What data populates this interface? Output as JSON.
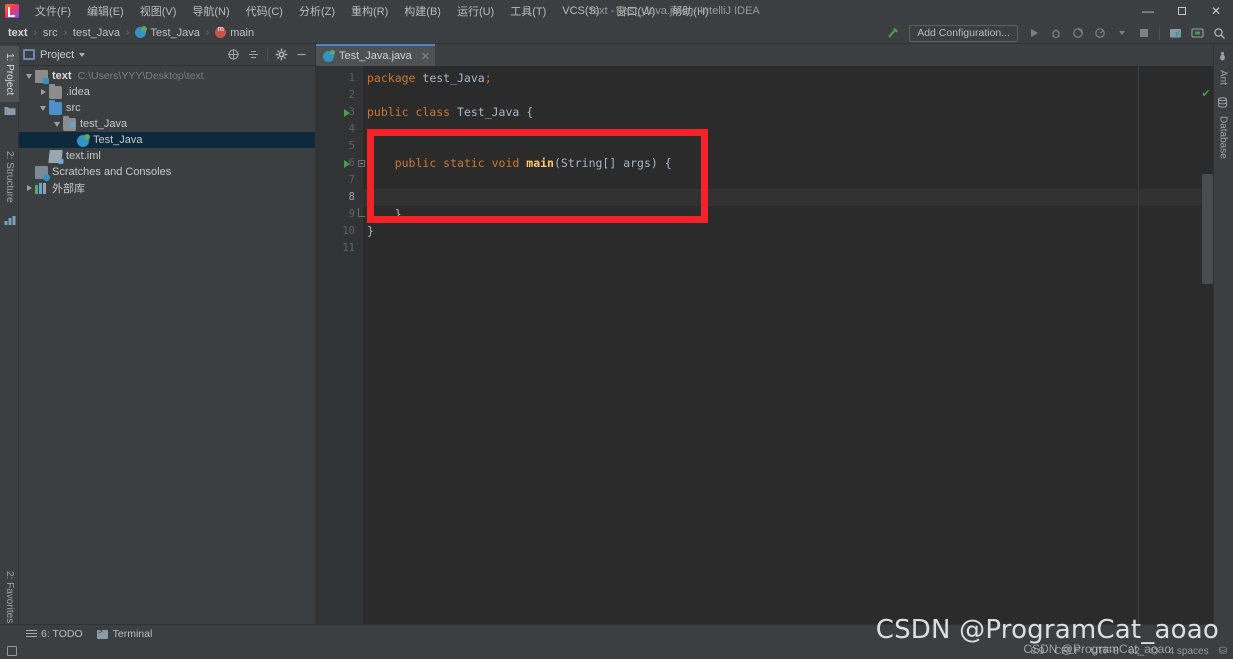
{
  "window": {
    "title": "text - Test_Java.java - IntelliJ IDEA",
    "minimize": "—",
    "maximize": "❐",
    "close": "✕"
  },
  "menubar": {
    "items": [
      {
        "label": "文件(F)"
      },
      {
        "label": "编辑(E)"
      },
      {
        "label": "视图(V)"
      },
      {
        "label": "导航(N)"
      },
      {
        "label": "代码(C)"
      },
      {
        "label": "分析(Z)"
      },
      {
        "label": "重构(R)"
      },
      {
        "label": "构建(B)"
      },
      {
        "label": "运行(U)"
      },
      {
        "label": "工具(T)"
      },
      {
        "label": "VCS(S)"
      },
      {
        "label": "窗口(W)"
      },
      {
        "label": "帮助(H)"
      }
    ]
  },
  "breadcrumb": {
    "items": [
      {
        "label": "text",
        "icon": "none",
        "bold": true
      },
      {
        "label": "src",
        "icon": "none",
        "bold": false
      },
      {
        "label": "test_Java",
        "icon": "none",
        "bold": false
      },
      {
        "label": "Test_Java",
        "icon": "class-icon",
        "bold": false
      },
      {
        "label": "main",
        "icon": "method-icon",
        "bold": false
      }
    ],
    "separator": "›"
  },
  "toolbar": {
    "build_label": "↖",
    "run_config_label": "Add Configuration...",
    "buttons": [
      {
        "name": "run-button",
        "glyph": "▶"
      },
      {
        "name": "debug-button",
        "glyph": "ὁe"
      },
      {
        "name": "run-with-coverage-button",
        "glyph": "◔"
      },
      {
        "name": "profile-button",
        "glyph": "◑"
      },
      {
        "name": "profile-dropdown",
        "glyph": "▾"
      },
      {
        "name": "stop-button",
        "glyph": "■"
      },
      {
        "name": "project-structure-button",
        "glyph": "▤"
      },
      {
        "name": "screen-button",
        "glyph": "▣"
      },
      {
        "name": "search-everywhere-button",
        "glyph": "⌕"
      }
    ]
  },
  "left_strip": {
    "tabs": [
      {
        "label": "1: Project",
        "active": true
      },
      {
        "label": "2: Structure",
        "active": false
      },
      {
        "label": "2: Favorites",
        "active": false
      }
    ]
  },
  "right_strip": {
    "tabs": [
      {
        "label": "Ant"
      },
      {
        "label": "Database"
      }
    ]
  },
  "project_panel": {
    "title": "Project",
    "actions": [
      {
        "name": "scope-button",
        "glyph": "⊕"
      },
      {
        "name": "collapse-all-button",
        "glyph": "≡"
      },
      {
        "name": "settings-gear-button",
        "glyph": "⚙"
      },
      {
        "name": "hide-panel-button",
        "glyph": "—"
      }
    ],
    "tree": [
      {
        "label": "text",
        "path": "C:\\Users\\YYY\\Desktop\\text",
        "indent": 0,
        "twisty": "down",
        "icon": "module-icon",
        "bold": true,
        "selected": false
      },
      {
        "label": ".idea",
        "path": "",
        "indent": 1,
        "twisty": "right",
        "icon": "folder-icon",
        "bold": false,
        "selected": false
      },
      {
        "label": "src",
        "path": "",
        "indent": 1,
        "twisty": "down",
        "icon": "source-folder-icon",
        "bold": false,
        "selected": false
      },
      {
        "label": "test_Java",
        "path": "",
        "indent": 2,
        "twisty": "down",
        "icon": "package-icon",
        "bold": false,
        "selected": false
      },
      {
        "label": "Test_Java",
        "path": "",
        "indent": 3,
        "twisty": "none",
        "icon": "java-class-icon",
        "bold": false,
        "selected": true
      },
      {
        "label": "text.iml",
        "path": "",
        "indent": 1,
        "twisty": "none",
        "icon": "iml-file-icon",
        "bold": false,
        "selected": false
      },
      {
        "label": "Scratches and Consoles",
        "path": "",
        "indent": 0,
        "twisty": "none",
        "icon": "scratches-icon",
        "bold": false,
        "selected": false
      },
      {
        "label": "外部库",
        "path": "",
        "indent": 0,
        "twisty": "right",
        "icon": "library-icon",
        "bold": false,
        "selected": false
      }
    ]
  },
  "editor": {
    "tab": {
      "label": "Test_Java.java",
      "close_glyph": "✕"
    },
    "caret_line": 8,
    "lines": [
      {
        "num": 1,
        "runnable": false,
        "fold": "none",
        "tokens": [
          {
            "t": "package",
            "c": "kw"
          },
          {
            "t": " test_Java",
            "c": "plain"
          },
          {
            "t": ";",
            "c": "semi"
          }
        ]
      },
      {
        "num": 2,
        "runnable": false,
        "fold": "none",
        "tokens": []
      },
      {
        "num": 3,
        "runnable": true,
        "fold": "none",
        "tokens": [
          {
            "t": "public class",
            "c": "kw"
          },
          {
            "t": " Test_Java {",
            "c": "plain"
          }
        ]
      },
      {
        "num": 4,
        "runnable": false,
        "fold": "none",
        "tokens": []
      },
      {
        "num": 5,
        "runnable": false,
        "fold": "none",
        "tokens": []
      },
      {
        "num": 6,
        "runnable": true,
        "fold": "open",
        "tokens": [
          {
            "t": "    ",
            "c": "plain"
          },
          {
            "t": "public static void",
            "c": "kw"
          },
          {
            "t": " ",
            "c": "plain"
          },
          {
            "t": "main",
            "c": "fn"
          },
          {
            "t": "(String[] args) {",
            "c": "plain"
          }
        ]
      },
      {
        "num": 7,
        "runnable": false,
        "fold": "none",
        "tokens": []
      },
      {
        "num": 8,
        "runnable": false,
        "fold": "none",
        "tokens": []
      },
      {
        "num": 9,
        "runnable": false,
        "fold": "close",
        "tokens": [
          {
            "t": "    }",
            "c": "plain"
          }
        ]
      },
      {
        "num": 10,
        "runnable": false,
        "fold": "none",
        "tokens": [
          {
            "t": "}",
            "c": "plain"
          }
        ]
      },
      {
        "num": 11,
        "runnable": false,
        "fold": "none",
        "tokens": []
      }
    ],
    "inspection_glyph": "✔",
    "annotation": {
      "name": "red-highlight-rectangle",
      "color": "#f42229"
    }
  },
  "bottom_bar": {
    "items": [
      {
        "label": "6: TODO",
        "icon": "todo-icon"
      },
      {
        "label": "Terminal",
        "icon": "terminal-icon"
      }
    ]
  },
  "status_bar": {
    "left_icon": "event-log-icon",
    "right": [
      {
        "label": "8:9",
        "name": "caret-position"
      },
      {
        "label": "CRLF",
        "name": "line-separator"
      },
      {
        "label": "UTF-8",
        "name": "file-encoding"
      },
      {
        "label": "ὑ2",
        "name": "lock-icon"
      },
      {
        "label": "⌬",
        "name": "git-branch-icon"
      },
      {
        "label": "4 spaces",
        "name": "indent-setting"
      },
      {
        "label": "⛁",
        "name": "inspection-profile-icon"
      }
    ]
  },
  "watermark": {
    "main": "CSDN @ProgramCat_aoao",
    "sub": "CSDN @ProgramCat_aoao"
  },
  "colors": {
    "accent_blue": "#4a88c7",
    "keyword_orange": "#cc7832",
    "method_yellow": "#ffc66d",
    "plain_text": "#a9b7c6",
    "editor_bg": "#2b2b2b",
    "panel_bg": "#3c3f41",
    "selection_blue": "#0d293e",
    "annotation_red": "#f42229"
  }
}
